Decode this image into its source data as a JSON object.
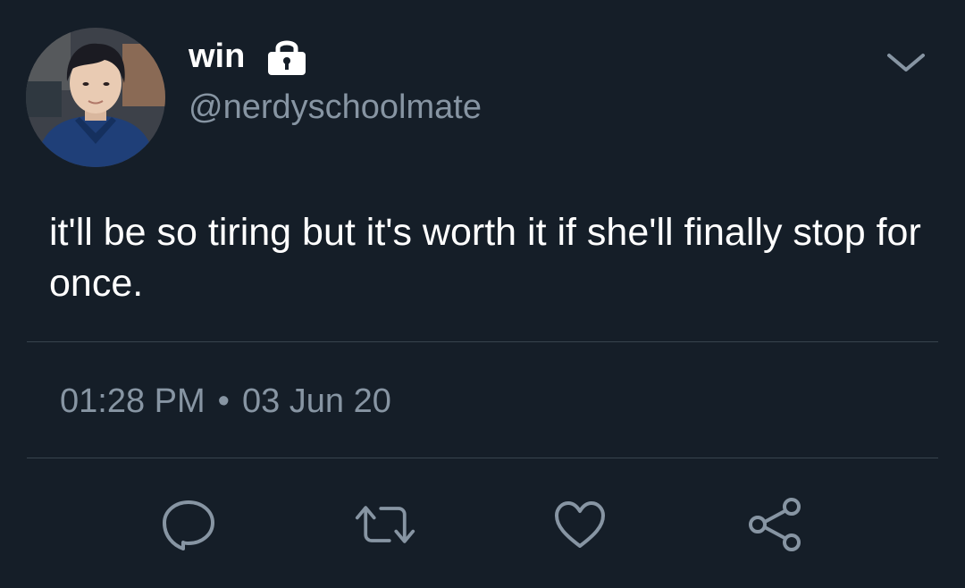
{
  "tweet": {
    "display_name": "win",
    "handle": "@nerdyschoolmate",
    "text": "it'll be so tiring but it's worth it if she'll finally stop for once.",
    "time": "01:28 PM",
    "separator": "•",
    "date": "03 Jun 20",
    "avatar_icon": "profile-photo",
    "protected_icon": "lock-icon",
    "menu_icon": "chevron-down-icon"
  },
  "actions": {
    "reply_icon": "reply-icon",
    "retweet_icon": "retweet-icon",
    "like_icon": "heart-icon",
    "share_icon": "share-icon"
  },
  "colors": {
    "background": "#151e28",
    "primary_text": "#ffffff",
    "secondary_text": "#8795a3",
    "divider": "#38444d"
  }
}
